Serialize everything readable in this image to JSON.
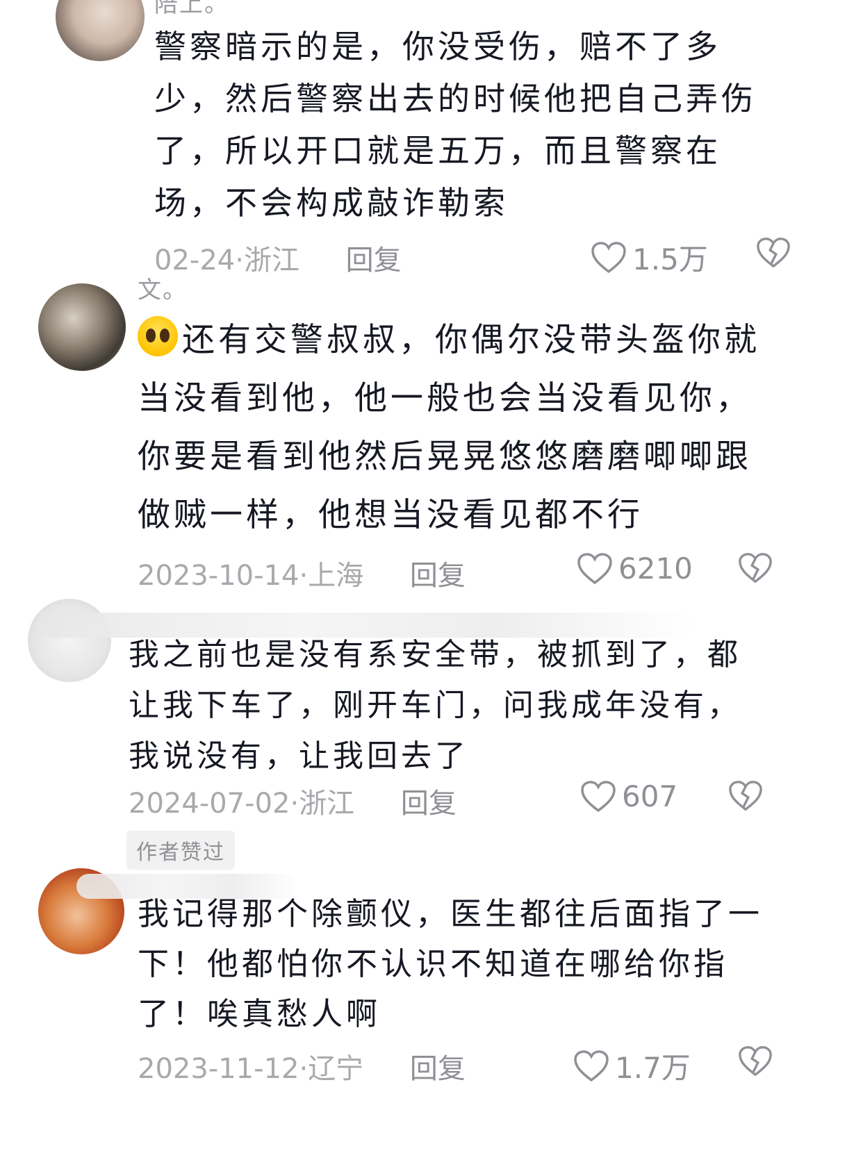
{
  "comments": [
    {
      "name_stub": "陪上。",
      "text": "警察暗示的是，你没受伤，赔不了多少，然后警察出去的时候他把自己弄伤了，所以开口就是五万，而且警察在场，不会构成敲诈勒索",
      "date": "02-24",
      "location": "浙江",
      "reply": "回复",
      "likes": "1.5万"
    },
    {
      "name_stub": "文。",
      "emoji": "crying-face-emoji",
      "text": "还有交警叔叔，你偶尔没带头盔你就当没看到他，他一般也会当没看见你，你要是看到他然后晃晃悠悠磨磨唧唧跟做贼一样，他想当没看见都不行",
      "date": "2023-10-14",
      "location": "上海",
      "reply": "回复",
      "likes": "6210"
    },
    {
      "text": "我之前也是没有系安全带，被抓到了，都让我下车了，刚开车门，问我成年没有，我说没有，让我回去了",
      "date": "2024-07-02",
      "location": "浙江",
      "reply": "回复",
      "likes": "607",
      "badge": "作者赞过"
    },
    {
      "text": "我记得那个除颤仪，医生都往后面指了一下！他都怕你不认识不知道在哪给你指了！唉真愁人啊",
      "date": "2023-11-12",
      "location": "辽宁",
      "reply": "回复",
      "likes": "1.7万"
    }
  ],
  "separator": " · ",
  "icons": {
    "like": "heart-outline-icon",
    "dislike": "broken-heart-icon"
  },
  "colors": {
    "text": "#161823",
    "meta": "#a8a9ad",
    "icon": "#8f9095"
  }
}
